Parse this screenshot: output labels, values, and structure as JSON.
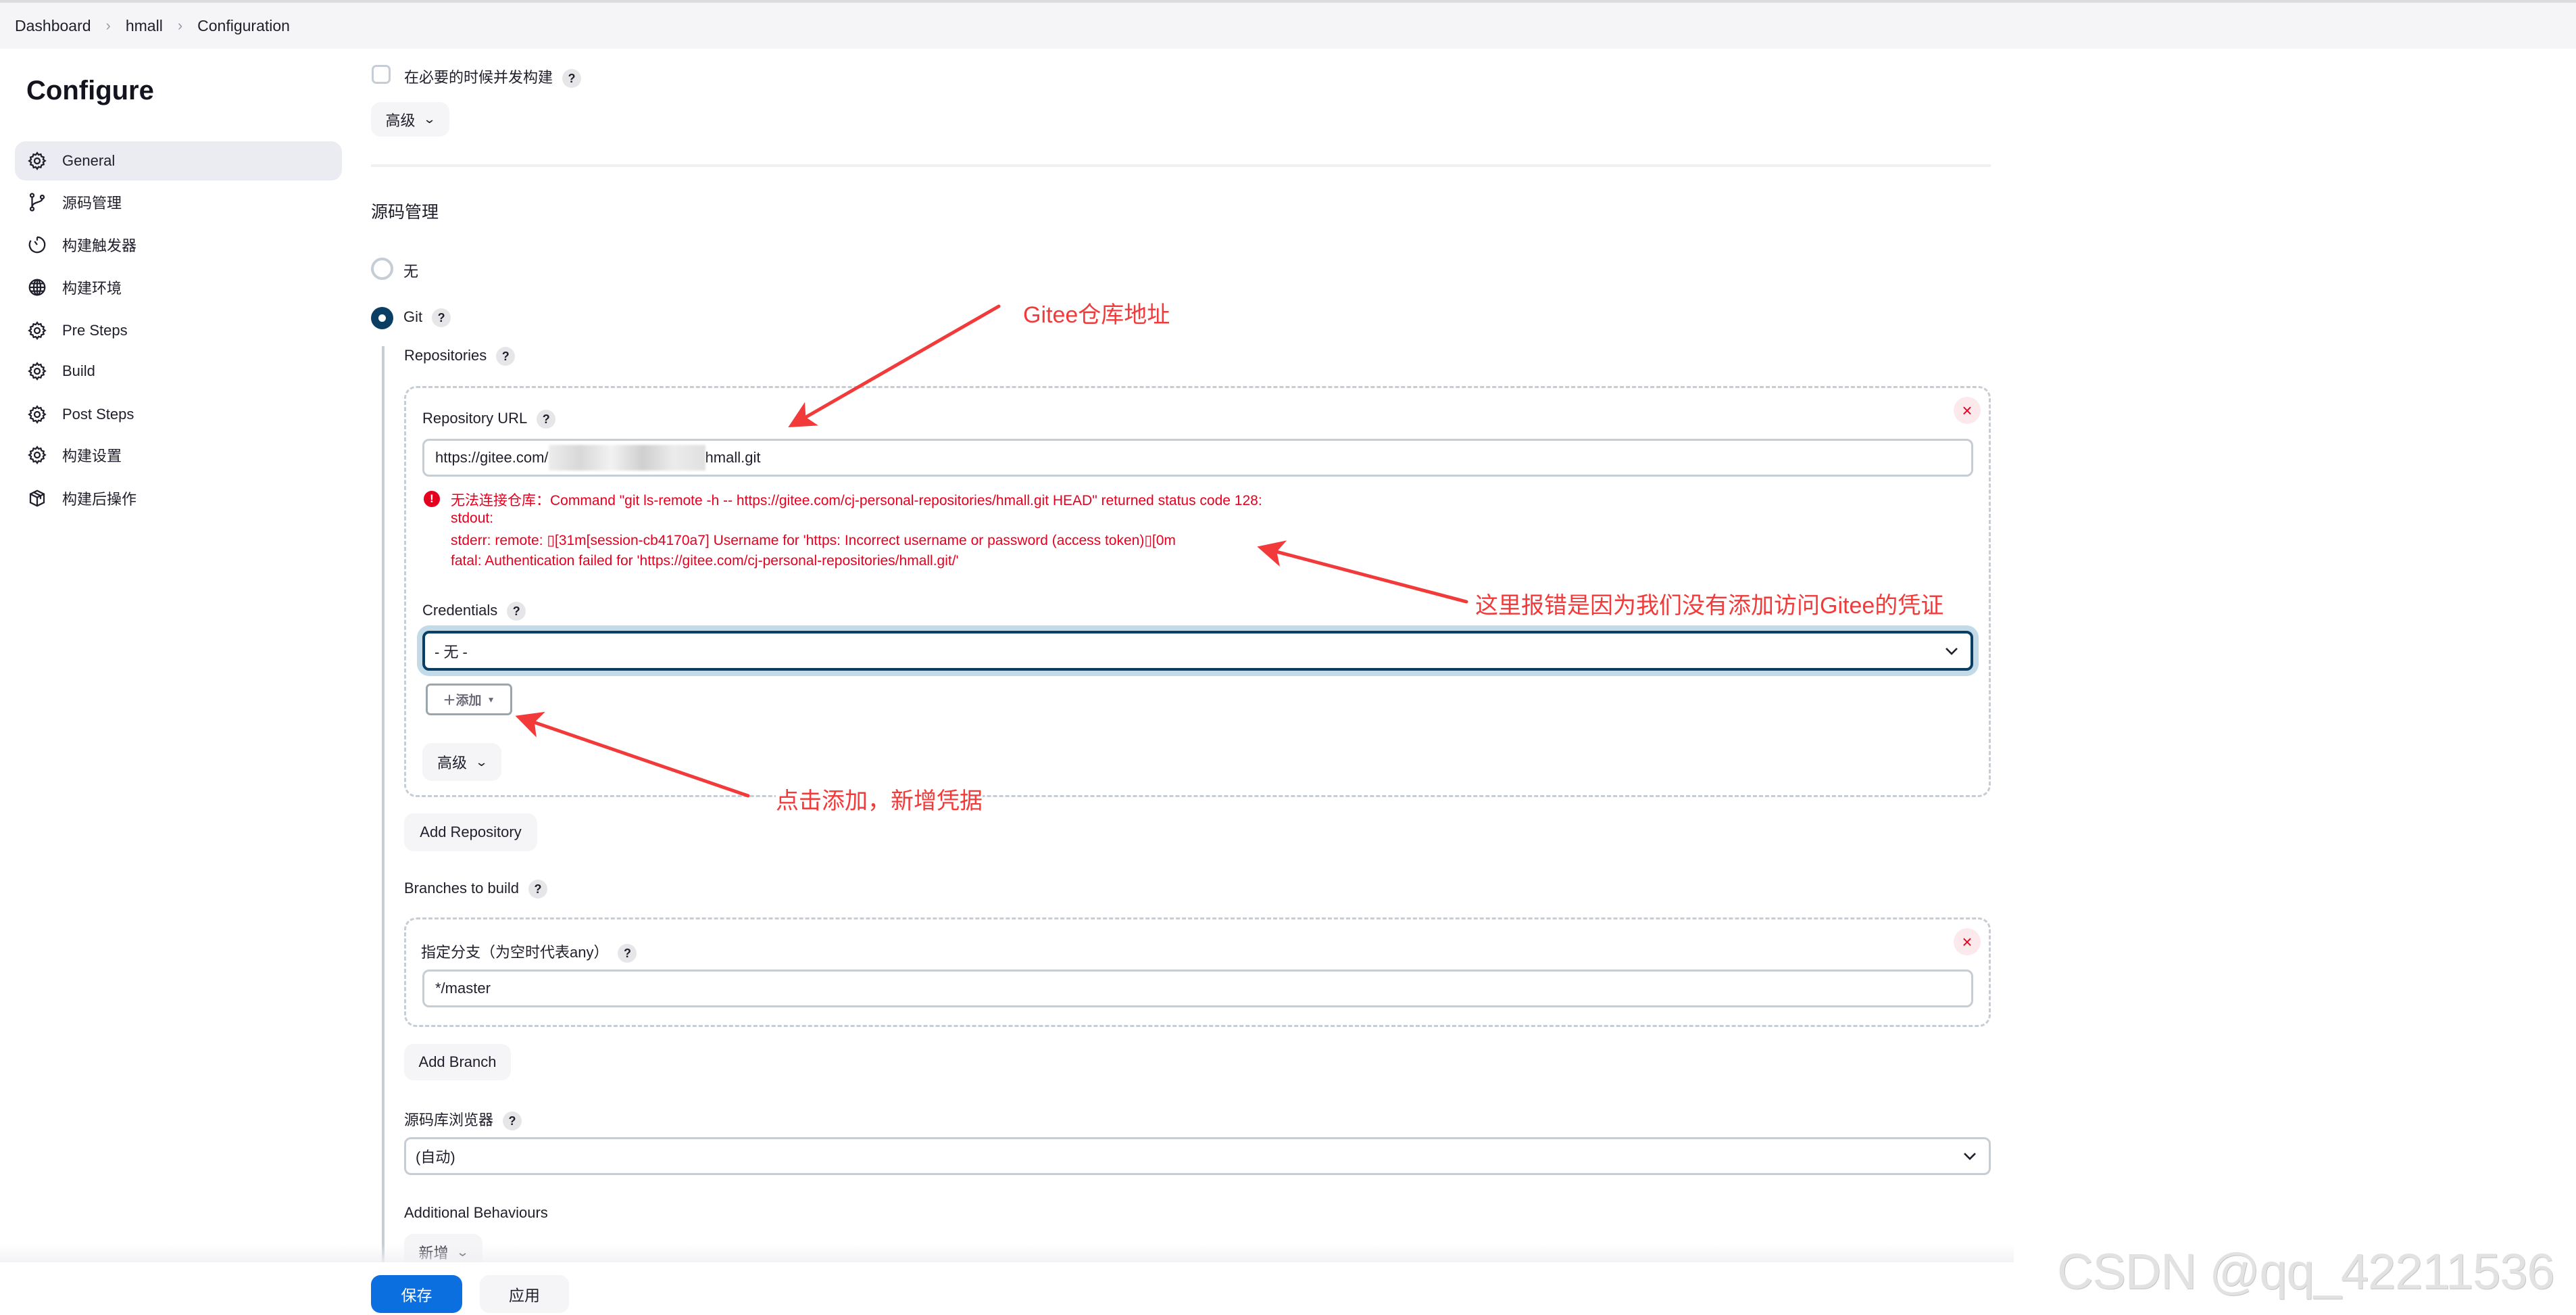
{
  "breadcrumb": {
    "items": [
      "Dashboard",
      "hmall",
      "Configuration"
    ]
  },
  "sidebar": {
    "title": "Configure",
    "items": [
      {
        "label": "General",
        "icon": "gear-icon",
        "active": true
      },
      {
        "label": "源码管理",
        "icon": "branch-icon"
      },
      {
        "label": "构建触发器",
        "icon": "timer-icon"
      },
      {
        "label": "构建环境",
        "icon": "globe-icon"
      },
      {
        "label": "Pre Steps",
        "icon": "gear-icon"
      },
      {
        "label": "Build",
        "icon": "gear-icon"
      },
      {
        "label": "Post Steps",
        "icon": "gear-icon"
      },
      {
        "label": "构建设置",
        "icon": "gear-icon"
      },
      {
        "label": "构建后操作",
        "icon": "package-icon"
      }
    ]
  },
  "general": {
    "concurrent_build_label": "在必要的时候并发构建",
    "concurrent_build_checked": false,
    "advanced_label": "高级"
  },
  "scm": {
    "heading": "源码管理",
    "options": [
      {
        "label": "无",
        "selected": false
      },
      {
        "label": "Git",
        "selected": true
      }
    ],
    "repositories_label": "Repositories",
    "repository": {
      "url_label": "Repository URL",
      "url_prefix": "https://gitee.com/",
      "url_suffix": "hmall.git",
      "error_lines": [
        "无法连接仓库：Command \"git ls-remote -h -- https://gitee.com/cj-personal-repositories/hmall.git HEAD\" returned status code 128:",
        "stdout:",
        "stderr: remote: ▯[31m[session-cb4170a7] Username for 'https: Incorrect username or password (access token)▯[0m",
        "fatal: Authentication failed for 'https://gitee.com/cj-personal-repositories/hmall.git/'"
      ],
      "credentials_label": "Credentials",
      "credentials_value": "- 无 -",
      "add_label": "＋添加",
      "advanced_label": "高级"
    },
    "add_repository_label": "Add Repository",
    "branches_label": "Branches to build",
    "branch": {
      "label": "指定分支（为空时代表any）",
      "value": "*/master"
    },
    "add_branch_label": "Add Branch",
    "browser_label": "源码库浏览器",
    "browser_value": "(自动)",
    "additional_behaviours_label": "Additional Behaviours",
    "add_behaviour_label": "新增"
  },
  "footer": {
    "save_label": "保存",
    "apply_label": "应用"
  },
  "annotations": {
    "repo_url_note": "Gitee仓库地址",
    "error_note": "这里报错是因为我们没有添加访问Gitee的凭证",
    "add_note": "点击添加，新增凭据"
  },
  "watermark": "CSDN @qq_42211536",
  "colors": {
    "primary": "#0b6fe0",
    "radio_selected": "#0b3e63",
    "error": "#e6001f",
    "annotation": "#f23a3a"
  }
}
